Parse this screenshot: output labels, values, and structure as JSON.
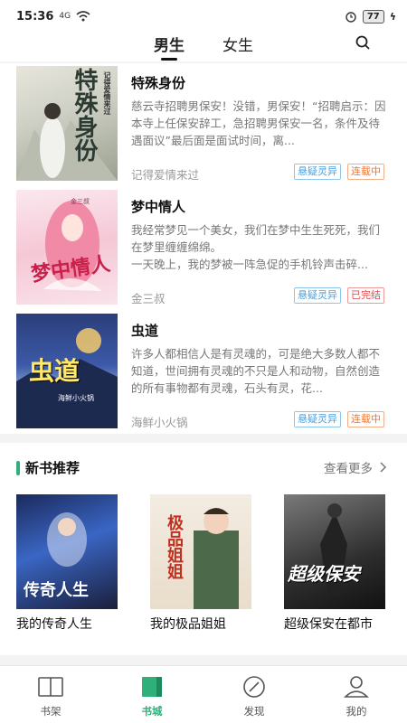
{
  "status": {
    "time": "15:36",
    "network": "4G",
    "battery": "77"
  },
  "tabs": [
    {
      "label": "男生"
    },
    {
      "label": "女生"
    }
  ],
  "books": [
    {
      "title": "特殊身份",
      "cover_title": "特殊身份",
      "cover_author": "记得爱情来过",
      "desc": "慈云寺招聘男保安！没错，男保安！“招聘启示：因本寺上任保安辞工，急招聘男保安一名，条件及待遇面议”最后面是面试时间，离...",
      "author": "记得爱情来过",
      "genre": "悬疑灵异",
      "status": "连载中"
    },
    {
      "title": "梦中情人",
      "cover_title": "梦中情人",
      "cover_author": "金三叔",
      "desc": "我经常梦见一个美女，我们在梦中生生死死，我们在梦里缠缠绵绵。\n一天晚上，我的梦被一阵急促的手机铃声击碎...",
      "author": "金三叔",
      "genre": "悬疑灵异",
      "status": "已完结"
    },
    {
      "title": "虫道",
      "cover_title": "虫道",
      "cover_author": "海鲜小火锅",
      "desc": "许多人都相信人是有灵魂的，可是绝大多数人都不知道，世间拥有灵魂的不只是人和动物，自然创造的所有事物都有灵魂，石头有灵，花...",
      "author": "海鲜小火锅",
      "genre": "悬疑灵异",
      "status": "连载中"
    }
  ],
  "new_books": {
    "section_title": "新书推荐",
    "see_more": "查看更多",
    "items": [
      {
        "name": "我的传奇人生",
        "cover_title": "传奇人生"
      },
      {
        "name": "我的极品姐姐",
        "cover_title": "极品姐姐"
      },
      {
        "name": "超级保安在都市",
        "cover_title": "超级保安"
      }
    ]
  },
  "bottom_nav": [
    {
      "label": "书架",
      "icon": "bookshelf-icon"
    },
    {
      "label": "书城",
      "icon": "bookstore-icon"
    },
    {
      "label": "发现",
      "icon": "compass-icon"
    },
    {
      "label": "我的",
      "icon": "user-icon"
    }
  ],
  "colors": {
    "accent": "#2fb07a",
    "genre_tag": "#4aa3e0",
    "serial_tag": "#e9783a",
    "done_tag": "#e04b4b"
  }
}
